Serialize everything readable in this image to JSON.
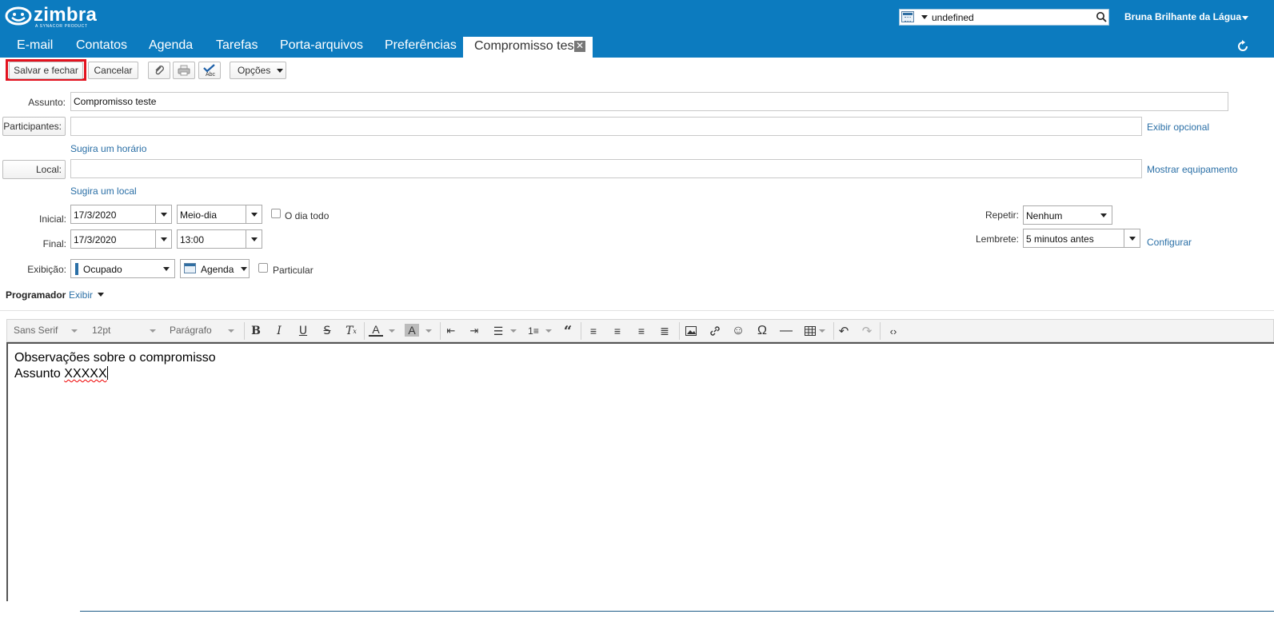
{
  "app": {
    "brand": "zimbra",
    "brand_tagline": "A SYNACOR PRODUCT",
    "accent_color": "#0c7bbf",
    "highlight_color": "#e3121f"
  },
  "header": {
    "search_value": "undefined",
    "search_type_icon": "calendar-icon",
    "user_name": "Bruna Brilhante da Lágua"
  },
  "tabs": [
    {
      "label": "E-mail"
    },
    {
      "label": "Contatos"
    },
    {
      "label": "Agenda"
    },
    {
      "label": "Tarefas"
    },
    {
      "label": "Porta-arquivos"
    },
    {
      "label": "Preferências"
    }
  ],
  "active_tab": {
    "label": "Compromisso tes",
    "close_glyph": "✕"
  },
  "toolbar": {
    "save_label": "Salvar e fechar",
    "cancel_label": "Cancelar",
    "options_label": "Opções"
  },
  "form": {
    "subject_label": "Assunto:",
    "subject_value": "Compromisso teste",
    "attendees_label": "Participantes:",
    "attendees_value": "",
    "show_optional_link": "Exibir opcional",
    "suggest_time_link": "Sugira um horário",
    "location_label": "Local:",
    "location_value": "",
    "show_equipment_link": "Mostrar equipamento",
    "suggest_location_link": "Sugira um local",
    "start_label": "Inicial:",
    "start_date": "17/3/2020",
    "start_time": "Meio-dia",
    "all_day_label": "O dia todo",
    "all_day_checked": false,
    "end_label": "Final:",
    "end_date": "17/3/2020",
    "end_time": "13:00",
    "repeat_label": "Repetir:",
    "repeat_value": "Nenhum",
    "reminder_label": "Lembrete:",
    "reminder_value": "5 minutos antes",
    "configure_link": "Configurar",
    "display_label": "Exibição:",
    "display_value": "Ocupado",
    "calendar_value": "Agenda",
    "private_label": "Particular",
    "private_checked": false,
    "scheduler_label": "Programador",
    "scheduler_show_link": "Exibir"
  },
  "editor_toolbar": {
    "font_family": "Sans Serif",
    "font_size": "12pt",
    "block_format": "Parágrafo"
  },
  "editor": {
    "line1": "Observações sobre o compromisso",
    "line2_prefix": "Assunto ",
    "line2_misspelled": "XXXXX"
  }
}
